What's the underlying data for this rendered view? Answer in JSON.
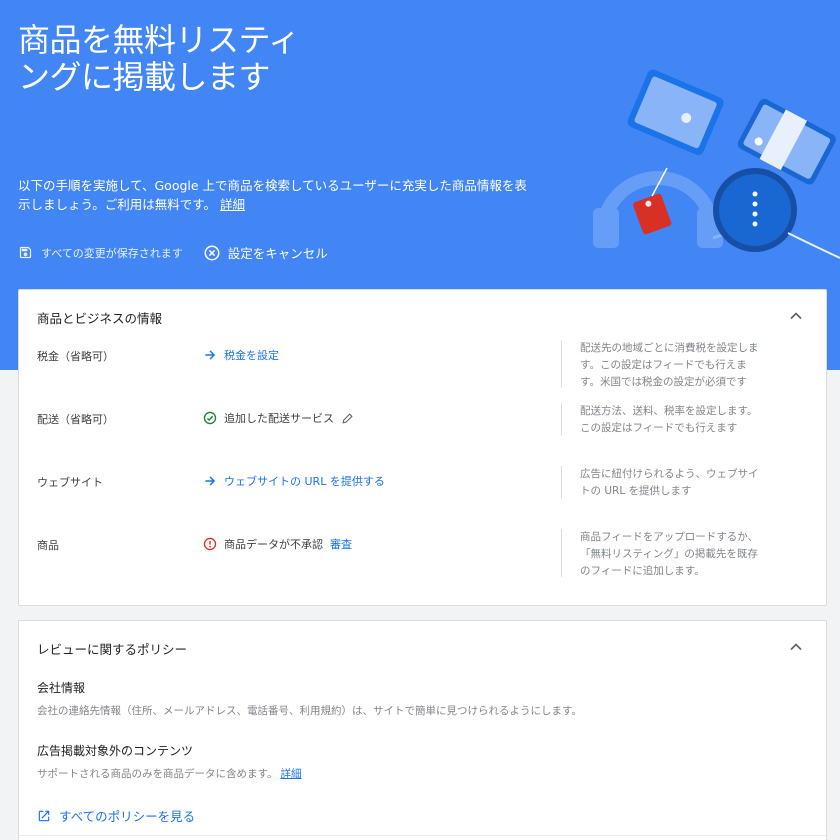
{
  "hero": {
    "title": "商品を無料リスティングに掲載します",
    "description": "以下の手順を実施して、Google 上で商品を検索しているユーザーに充実した商品情報を表示しましょう。ご利用は無料です。",
    "details_link": "詳細",
    "saved_status": "すべての変更が保存されます",
    "cancel_label": "設定をキャンセル"
  },
  "business_card": {
    "title": "商品とビジネスの情報",
    "rows": [
      {
        "label": "税金（省略可）",
        "action": "税金を設定",
        "help": "配送先の地域ごとに消費税を設定します。この設定はフィードでも行えます。米国では税金の設定が必須です"
      },
      {
        "label": "配送（省略可）",
        "action": "追加した配送サービス",
        "help": "配送方法、送料、税率を設定します。この設定はフィードでも行えます"
      },
      {
        "label": "ウェブサイト",
        "action": "ウェブサイトの URL を提供する",
        "help": "広告に紐付けられるよう、ウェブサイトの URL を提供します"
      },
      {
        "label": "商品",
        "action": "商品データが不承認",
        "action_link": "審査",
        "help": "商品フィードをアップロードするか、「無料リスティング」の掲載先を既存のフィードに追加します。"
      }
    ]
  },
  "policy_card": {
    "title": "レビューに関するポリシー",
    "policies": [
      {
        "title": "会社情報",
        "desc": "会社の連絡先情報（住所、メールアドレス、電話番号、利用規約）は、サイトで簡単に見つけられるようにします。"
      },
      {
        "title": "広告掲載対象外のコンテンツ",
        "desc": "サポートされる商品のみを商品データに含めます。",
        "link": "詳細"
      }
    ],
    "see_all": "すべてのポリシーを見る"
  },
  "colors": {
    "hero_bg": "#4285f4",
    "link": "#1a73e8",
    "success": "#188038",
    "error": "#d93025"
  }
}
